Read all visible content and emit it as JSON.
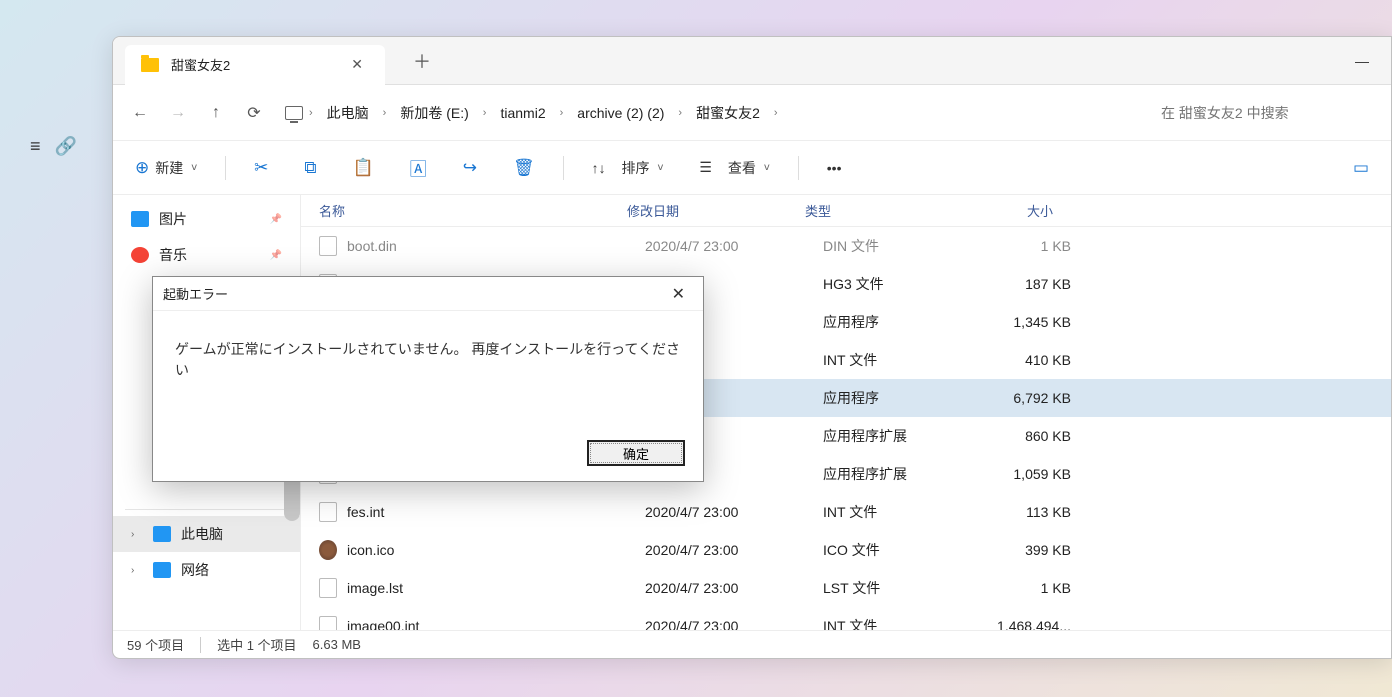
{
  "left_toolbar": {
    "i1": "≡",
    "i2": "🔗"
  },
  "tab": {
    "title": "甜蜜女友2"
  },
  "breadcrumb": [
    "此电脑",
    "新加卷 (E:)",
    "tianmi2",
    "archive (2) (2)",
    "甜蜜女友2"
  ],
  "search": {
    "placeholder": "在 甜蜜女友2 中搜索"
  },
  "toolbar": {
    "new": "新建",
    "sort": "排序",
    "view": "查看"
  },
  "columns": {
    "name": "名称",
    "date": "修改日期",
    "type": "类型",
    "size": "大小"
  },
  "sidebar": {
    "pictures": "图片",
    "music": "音乐",
    "thispc": "此电脑",
    "network": "网络"
  },
  "files": [
    {
      "name": "boot.din",
      "date": "2020/4/7 23:00",
      "type": "DIN 文件",
      "size": "1 KB",
      "cut": true
    },
    {
      "name": "",
      "date": "/7 23:00",
      "type": "HG3 文件",
      "size": "187 KB"
    },
    {
      "name": "",
      "date": "/7 23:00",
      "type": "应用程序",
      "size": "1,345 KB"
    },
    {
      "name": "",
      "date": "/7 23:00",
      "type": "INT 文件",
      "size": "410 KB"
    },
    {
      "name": "",
      "date": "/7 23:00",
      "type": "应用程序",
      "size": "6,792 KB",
      "selected": true
    },
    {
      "name": "",
      "date": "/7 23:00",
      "type": "应用程序扩展",
      "size": "860 KB"
    },
    {
      "name": "",
      "date": "/7 23:00",
      "type": "应用程序扩展",
      "size": "1,059 KB"
    },
    {
      "name": "fes.int",
      "date": "2020/4/7 23:00",
      "type": "INT 文件",
      "size": "113 KB"
    },
    {
      "name": "icon.ico",
      "date": "2020/4/7 23:00",
      "type": "ICO 文件",
      "size": "399 KB",
      "ico": true
    },
    {
      "name": "image.lst",
      "date": "2020/4/7 23:00",
      "type": "LST 文件",
      "size": "1 KB"
    },
    {
      "name": "image00.int",
      "date": "2020/4/7 23:00",
      "type": "INT 文件",
      "size": "1,468,494..."
    }
  ],
  "status": {
    "count": "59 个项目",
    "selected": "选中 1 个项目",
    "size": "6.63 MB"
  },
  "dialog": {
    "title": "起動エラー",
    "message": "ゲームが正常にインストールされていません。 再度インストールを行ってください",
    "ok": "确定"
  }
}
